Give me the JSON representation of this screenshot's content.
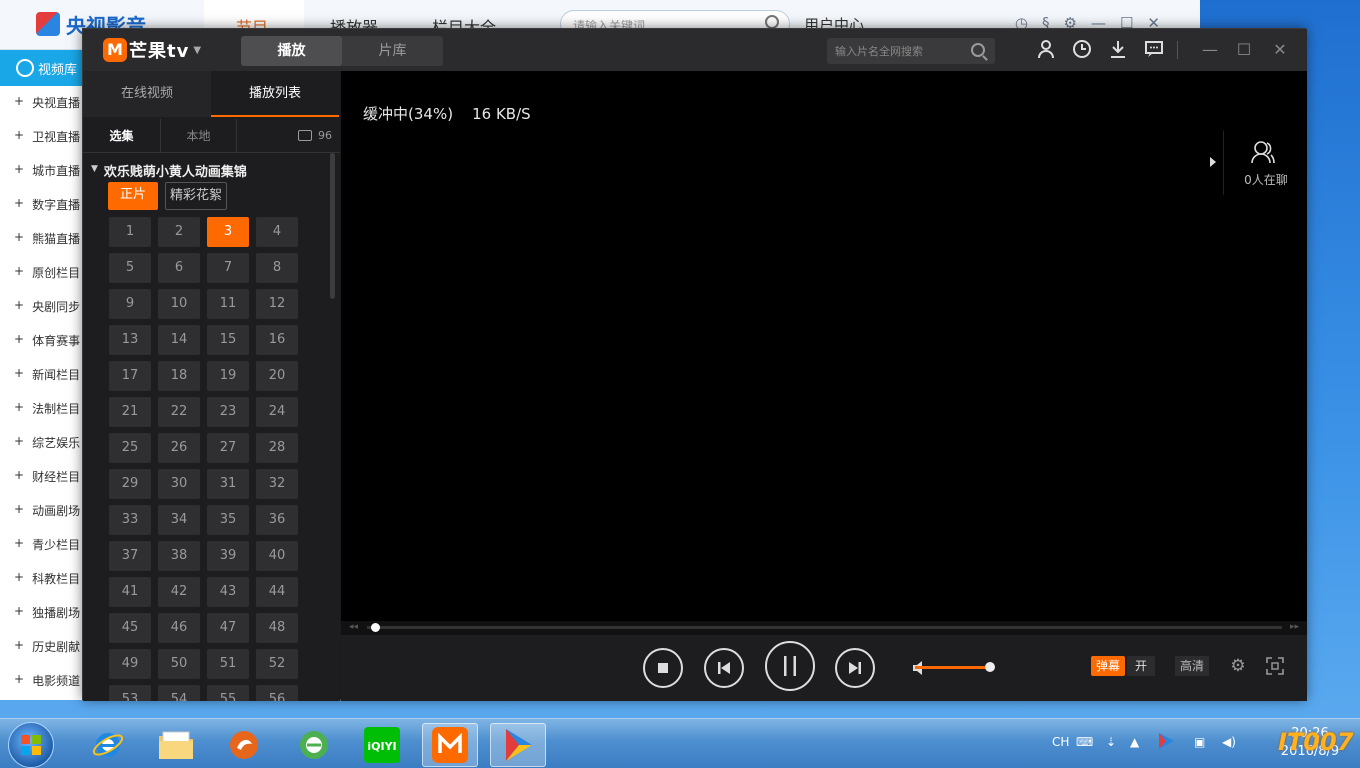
{
  "background_app": {
    "logo_text": "央视影音",
    "nav": [
      "节目",
      "播放器",
      "栏目大全"
    ],
    "search_placeholder": "请输入关键词",
    "user_center": "用户中心",
    "side_header": "视频库",
    "side_items": [
      "央视直播",
      "卫视直播",
      "城市直播",
      "数字直播",
      "熊猫直播",
      "原创栏目",
      "央剧同步",
      "体育赛事",
      "新闻栏目",
      "法制栏目",
      "综艺娱乐",
      "财经栏目",
      "动画剧场",
      "青少栏目",
      "科教栏目",
      "独播剧场",
      "历史剧献",
      "电影频道"
    ]
  },
  "mango": {
    "logo_text": "芒果tv",
    "logo_mark": "M",
    "top_tabs": [
      {
        "label": "播放",
        "active": true
      },
      {
        "label": "片库",
        "active": false
      }
    ],
    "search_placeholder": "输入片名全网搜索",
    "panel_tabs": [
      {
        "label": "在线视频",
        "active": false
      },
      {
        "label": "播放列表",
        "active": true
      }
    ],
    "sub_tabs": {
      "select": "选集",
      "local": "本地",
      "comment_count": "96"
    },
    "group_title": "欢乐贱萌小黄人动画集锦",
    "chips": {
      "main": "正片",
      "extras": "精彩花絮"
    },
    "episodes": [
      "1",
      "2",
      "3",
      "4",
      "5",
      "6",
      "7",
      "8",
      "9",
      "10",
      "11",
      "12",
      "13",
      "14",
      "15",
      "16",
      "17",
      "18",
      "19",
      "20",
      "21",
      "22",
      "23",
      "24",
      "25",
      "26",
      "27",
      "28",
      "29",
      "30",
      "31",
      "32",
      "33",
      "34",
      "35",
      "36",
      "37",
      "38",
      "39",
      "40",
      "41",
      "42",
      "43",
      "44",
      "45",
      "46",
      "47",
      "48",
      "49",
      "50",
      "51",
      "52",
      "53",
      "54",
      "55",
      "56"
    ],
    "active_episode": "3",
    "buffer_text": "缓冲中(34%)    16 KB/S",
    "chat_label": "0人在聊",
    "progress_fraction": 0.004,
    "volume_fraction": 1.0,
    "danmu_label": "弹幕",
    "danmu_state": "开",
    "quality_label": "高清",
    "accent_color": "#ff6a00"
  },
  "taskbar": {
    "lang": "CH",
    "time": "20:26",
    "date": "2016/8/9",
    "apps": [
      "internet-explorer",
      "file-explorer",
      "media-player",
      "360-browser",
      "iqiyi",
      "mango-tv",
      "cctv-player"
    ],
    "iqiyi_text": "iQIYI"
  },
  "watermark": "IT007"
}
